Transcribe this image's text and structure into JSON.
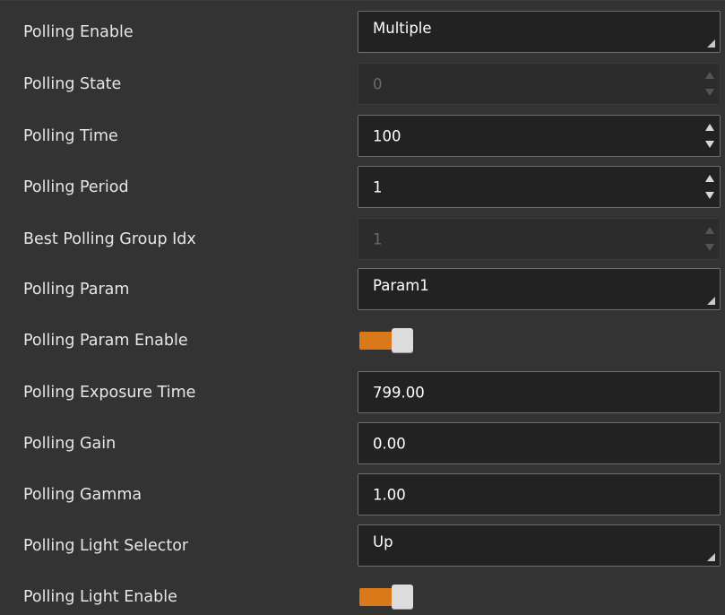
{
  "rows": [
    {
      "label": "Polling Enable",
      "value": "Multiple"
    },
    {
      "label": "Polling State",
      "value": "0"
    },
    {
      "label": "Polling Time",
      "value": "100"
    },
    {
      "label": "Polling Period",
      "value": "1"
    },
    {
      "label": "Best Polling Group Idx",
      "value": "1"
    },
    {
      "label": "Polling Param",
      "value": "Param1"
    },
    {
      "label": "Polling Param Enable"
    },
    {
      "label": "Polling Exposure Time",
      "value": "799.00"
    },
    {
      "label": "Polling Gain",
      "value": "0.00"
    },
    {
      "label": "Polling Gamma",
      "value": "1.00"
    },
    {
      "label": "Polling Light Selector",
      "value": "Up"
    },
    {
      "label": "Polling Light Enable"
    }
  ],
  "toggles": {
    "polling_param_enable": true,
    "polling_light_enable": true
  },
  "colors": {
    "panel_background": "#333333",
    "field_background": "#222222",
    "toggle_on": "#d9791a"
  }
}
